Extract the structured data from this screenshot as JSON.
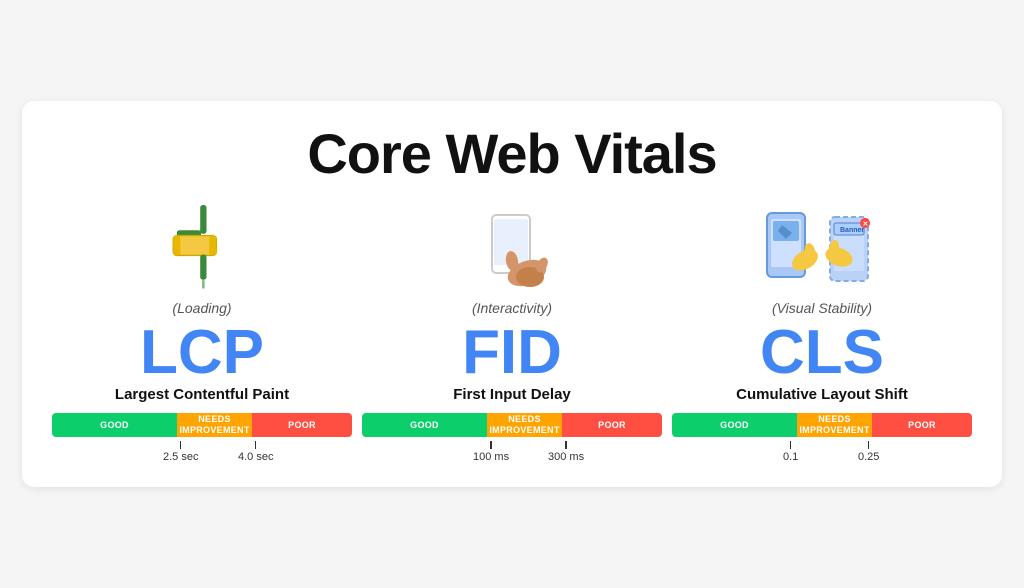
{
  "page": {
    "title": "Core Web Vitals",
    "background": "#f5f5f5"
  },
  "metrics": [
    {
      "id": "lcp",
      "subtitle": "(Loading)",
      "acronym": "LCP",
      "full_name": "Largest Contentful Paint",
      "icon_type": "paint_roller",
      "icon_emoji": "🖌️",
      "bar": {
        "good_label": "GOOD",
        "needs_label": "NEEDS\nIMPROVEMENT",
        "poor_label": "POOR"
      },
      "tick1_value": "2.5 sec",
      "tick2_value": "4.0 sec",
      "tick1_pos": "37%",
      "tick2_pos": "62%"
    },
    {
      "id": "fid",
      "subtitle": "(Interactivity)",
      "acronym": "FID",
      "full_name": "First Input Delay",
      "icon_type": "hand_phone",
      "icon_emoji": "📱",
      "bar": {
        "good_label": "GOOD",
        "needs_label": "NEEDS\nIMPROVEMENT",
        "poor_label": "POOR"
      },
      "tick1_value": "100 ms",
      "tick2_value": "300 ms",
      "tick1_pos": "37%",
      "tick2_pos": "62%"
    },
    {
      "id": "cls",
      "subtitle": "(Visual Stability)",
      "acronym": "CLS",
      "full_name": "Cumulative Layout Shift",
      "icon_type": "phone_shift",
      "icon_emoji": "📲",
      "bar": {
        "good_label": "GOOD",
        "needs_label": "NEEDS\nIMPROVEMENT",
        "poor_label": "POOR"
      },
      "tick1_value": "0.1",
      "tick2_value": "0.25",
      "tick1_pos": "37%",
      "tick2_pos": "62%"
    }
  ]
}
